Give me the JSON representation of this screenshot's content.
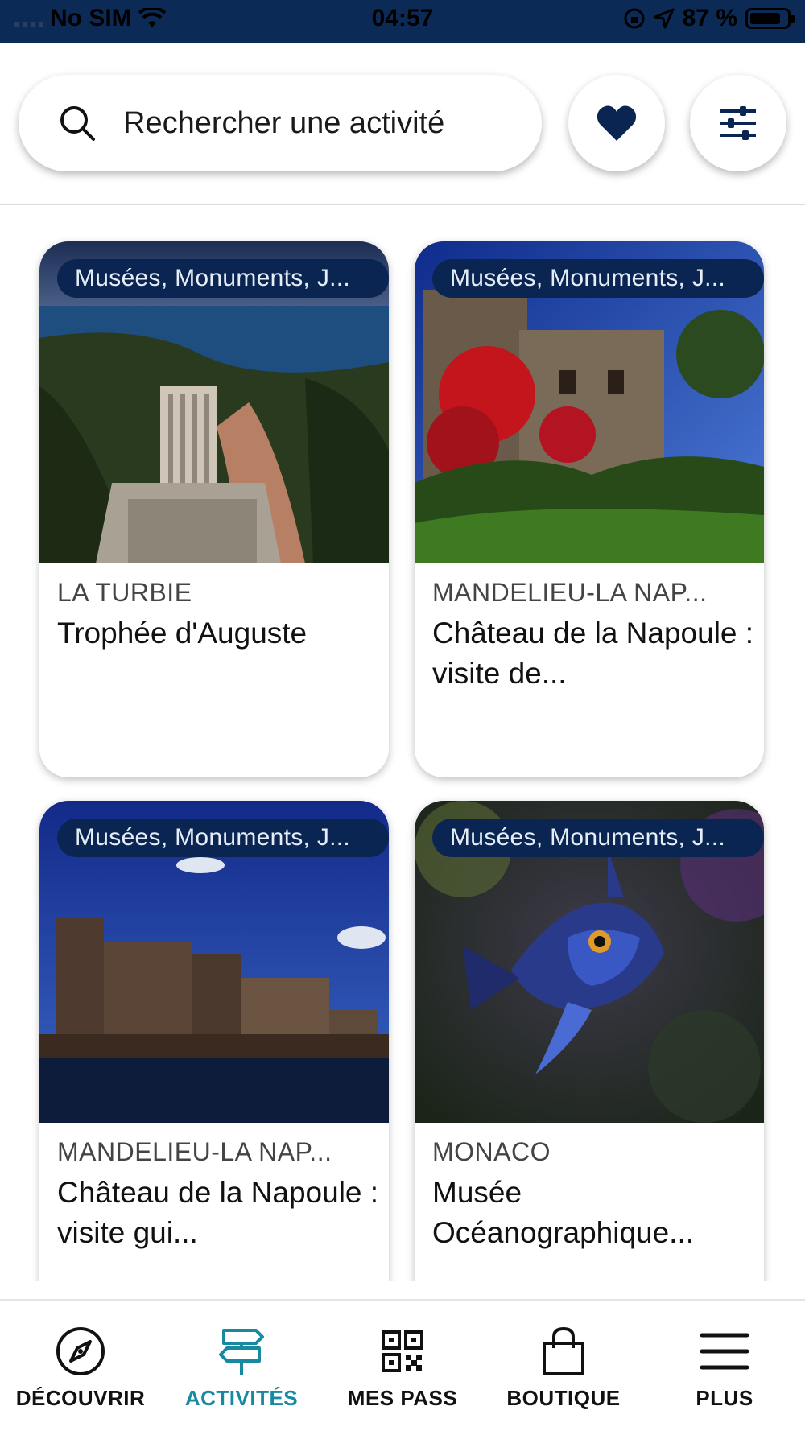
{
  "status_bar": {
    "carrier": "No SIM",
    "time": "04:57",
    "battery": "87 %"
  },
  "search": {
    "placeholder": "Rechercher une activité"
  },
  "colors": {
    "primary": "#0a2552",
    "accent": "#178aa0"
  },
  "cards": [
    {
      "tag": "Musées, Monuments, J...",
      "city": "LA TURBIE",
      "title": "Trophée d'Auguste"
    },
    {
      "tag": "Musées, Monuments, J...",
      "city": "MANDELIEU-LA NAP...",
      "title": "Château de la Napoule : visite de..."
    },
    {
      "tag": "Musées, Monuments, J...",
      "city": "MANDELIEU-LA NAP...",
      "title": "Château de la Napoule : visite gui..."
    },
    {
      "tag": "Musées, Monuments, J...",
      "city": "MONACO",
      "title": "Musée Océanographique..."
    }
  ],
  "nav": {
    "items": [
      {
        "label": "DÉCOUVRIR",
        "icon": "compass-icon"
      },
      {
        "label": "ACTIVITÉS",
        "icon": "signpost-icon",
        "active": true
      },
      {
        "label": "MES PASS",
        "icon": "qr-code-icon"
      },
      {
        "label": "BOUTIQUE",
        "icon": "shopping-bag-icon"
      },
      {
        "label": "PLUS",
        "icon": "menu-icon"
      }
    ]
  }
}
